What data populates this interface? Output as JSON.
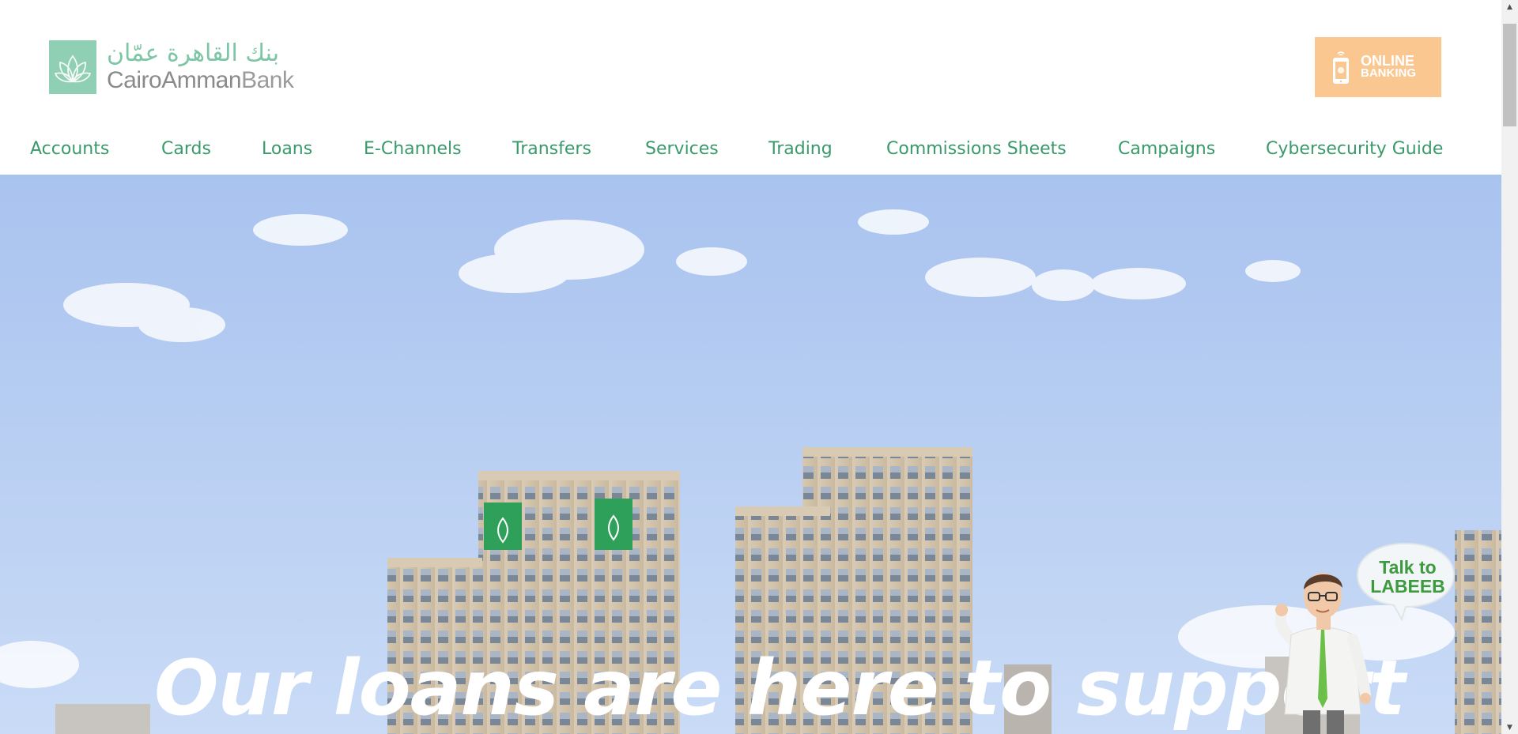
{
  "header": {
    "logo": {
      "arabic": "بنك القاهرة عمّان",
      "latin_main": "CairoAmman",
      "latin_suffix": "Bank"
    },
    "online_banking": {
      "line1": "ONLINE",
      "line2": "BANKING"
    }
  },
  "nav": {
    "items": [
      {
        "label": "Accounts"
      },
      {
        "label": "Cards"
      },
      {
        "label": "Loans"
      },
      {
        "label": "E-Channels"
      },
      {
        "label": "Transfers"
      },
      {
        "label": "Services"
      },
      {
        "label": "Trading"
      },
      {
        "label": "Commissions Sheets"
      },
      {
        "label": "Campaigns"
      },
      {
        "label": "Cybersecurity Guide"
      }
    ]
  },
  "hero": {
    "headline": "Our loans are here to support"
  },
  "labeeb": {
    "line1": "Talk to",
    "line2": "LABEEB"
  },
  "colors": {
    "brand_green": "#3a9a6b",
    "logo_green": "#8fcfb3",
    "online_banking_orange": "#fbc791",
    "sky": "#b7cdf4"
  }
}
